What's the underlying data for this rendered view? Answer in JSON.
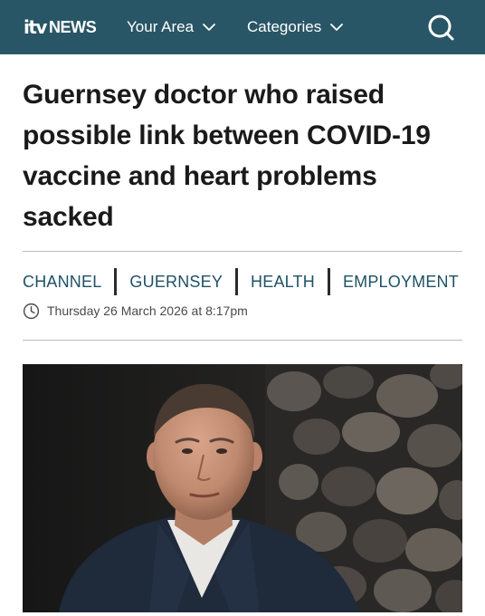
{
  "header": {
    "logo": {
      "mark": "itv",
      "word": "NEWS"
    },
    "nav": [
      {
        "label": "Your Area",
        "icon": "chevron-down-icon"
      },
      {
        "label": "Categories",
        "icon": "chevron-down-icon"
      }
    ],
    "search_icon": "search-icon",
    "background_color": "#295666"
  },
  "article": {
    "headline": "Guernsey doctor who raised possible link between COVID-19 vaccine and heart problems sacked",
    "tags": [
      "CHANNEL",
      "GUERNSEY",
      "HEALTH",
      "EMPLOYMENT"
    ],
    "tag_color": "#1f5166",
    "date": "Thursday 26 March 2026 at 8:17pm",
    "date_icon": "clock-icon"
  }
}
